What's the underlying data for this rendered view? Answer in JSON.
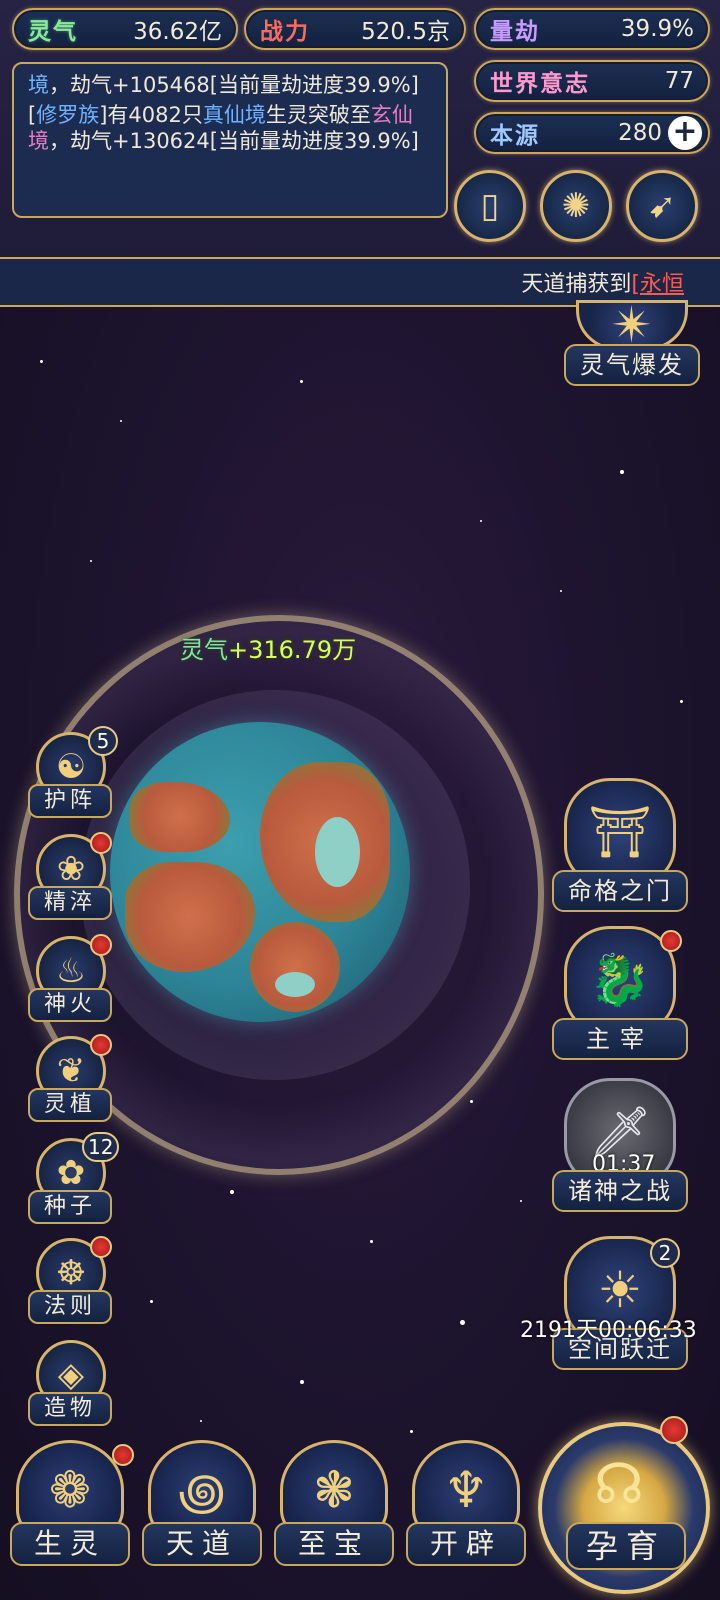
{
  "resources": {
    "lingqi": {
      "label": "灵气",
      "value": "36.62亿"
    },
    "zhanli": {
      "label": "战力",
      "value": "520.5京"
    },
    "liangjie": {
      "label": "量劫",
      "value": "39.9%"
    },
    "shijie_yizhi": {
      "label": "世界意志",
      "value": "77"
    },
    "benyuan": {
      "label": "本源",
      "value": "280"
    }
  },
  "log": {
    "line1": {
      "prefix": "境",
      "text": "，劫气+105468[当前量劫进度39.9%]"
    },
    "line2": {
      "race": "修罗族",
      "part1": "有4082只",
      "realm_from": "真仙境",
      "part2": "生灵突破至",
      "realm_to": "玄仙境",
      "part3": "，劫气+130624[当前量劫进度39.9%]"
    }
  },
  "top_buttons": [
    {
      "icon": "card-icon"
    },
    {
      "icon": "vortex-icon"
    },
    {
      "icon": "scroll-icon"
    }
  ],
  "ticker": {
    "text": "天道捕获到",
    "highlight": "[永恒"
  },
  "planet": {
    "gain_label": "灵气",
    "gain_value": "+316.79万"
  },
  "left_features": [
    {
      "label": "护阵",
      "badge": "5"
    },
    {
      "label": "精淬",
      "badge": ""
    },
    {
      "label": "神火",
      "badge": ""
    },
    {
      "label": "灵植",
      "badge": ""
    },
    {
      "label": "种子",
      "badge": "12"
    },
    {
      "label": "法则",
      "badge": ""
    },
    {
      "label": "造物",
      "badge": ""
    }
  ],
  "right_features": {
    "top": {
      "label": "灵气爆发"
    },
    "mingge": {
      "label": "命格之门"
    },
    "zhuzai": {
      "label": "主宰"
    },
    "zhushen": {
      "label": "诸神之战",
      "timer": "01:37"
    },
    "kongjian": {
      "label": "空间跃迁",
      "badge": "2",
      "timer": "2191天00:06:33"
    }
  },
  "bottom_nav": [
    {
      "label": "生灵"
    },
    {
      "label": "天道"
    },
    {
      "label": "至宝"
    },
    {
      "label": "开辟"
    }
  ],
  "nurture": {
    "label": "孕育"
  },
  "colors": {
    "gold": "#c9a85c",
    "panel": "#1c2f52",
    "alert_red": "#e23a32"
  }
}
